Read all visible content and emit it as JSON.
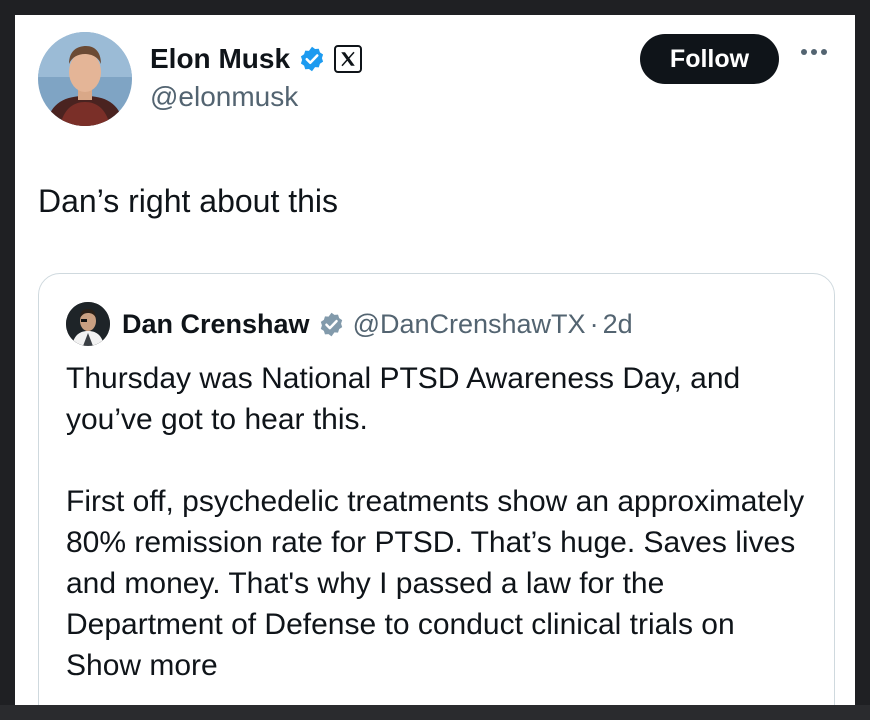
{
  "tweet": {
    "author": {
      "name": "Elon Musk",
      "handle": "@elonmusk",
      "verified_icon": "verified-badge-icon",
      "affiliation_icon": "x-logo-icon"
    },
    "follow_label": "Follow",
    "more_icon": "more-options-icon",
    "text": "Dan’s right about this"
  },
  "quote": {
    "author": {
      "name": "Dan Crenshaw",
      "handle": "@DanCrenshawTX",
      "separator": "·",
      "time": "2d",
      "verified_icon": "verified-badge-gray-icon"
    },
    "paragraph1": "Thursday was National PTSD Awareness Day, and you’ve got to hear this.",
    "paragraph2": "First off, psychedelic treatments show an approximately 80% remission rate for PTSD. That’s huge. Saves lives and money. That's why I passed a law for the Department of Defense to conduct clinical trials on",
    "show_more": "Show more"
  },
  "colors": {
    "text": "#0f1419",
    "secondary": "#536471",
    "verified_blue": "#1d9bf0",
    "border": "#cfd9de",
    "frame": "#1f2023"
  }
}
